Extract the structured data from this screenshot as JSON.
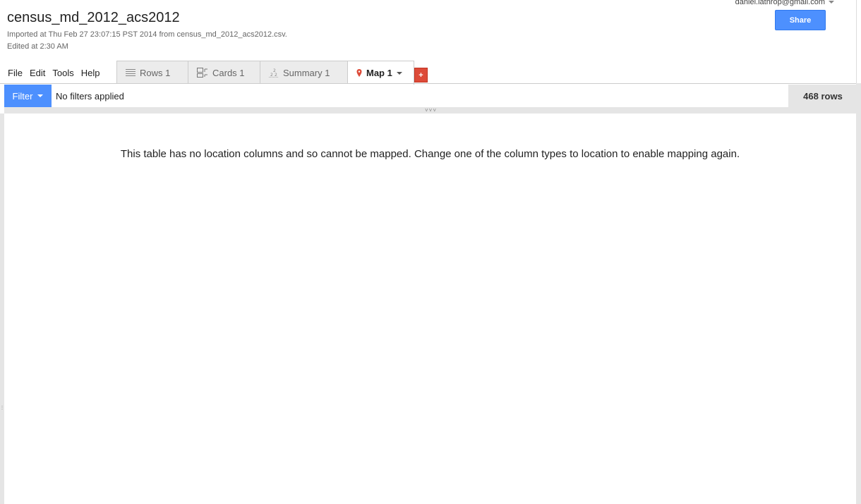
{
  "account": {
    "email": "daniel.lathrop@gmail.com"
  },
  "share": {
    "label": "Share"
  },
  "doc": {
    "title": "census_md_2012_acs2012",
    "imported": "Imported at Thu Feb 27 23:07:15 PST 2014 from census_md_2012_acs2012.csv.",
    "edited": "Edited at 2:30 AM"
  },
  "menu": {
    "file": "File",
    "edit": "Edit",
    "tools": "Tools",
    "help": "Help"
  },
  "tabs": [
    {
      "label": "Rows 1",
      "icon": "rows-icon"
    },
    {
      "label": "Cards 1",
      "icon": "cards-icon"
    },
    {
      "label": "Summary 1",
      "icon": "summary-icon"
    },
    {
      "label": "Map 1",
      "icon": "map-marker-icon",
      "active": true
    }
  ],
  "add_tab": {
    "label": "+"
  },
  "filter": {
    "button": "Filter",
    "status": "No filters applied",
    "row_count": "468 rows"
  },
  "map": {
    "message": "This table has no location columns and so cannot be mapped. Change one of the column types to location to enable mapping again."
  },
  "colors": {
    "accent_blue": "#4d90fe",
    "add_red": "#dd4b39",
    "marker_red": "#dd4b39"
  }
}
